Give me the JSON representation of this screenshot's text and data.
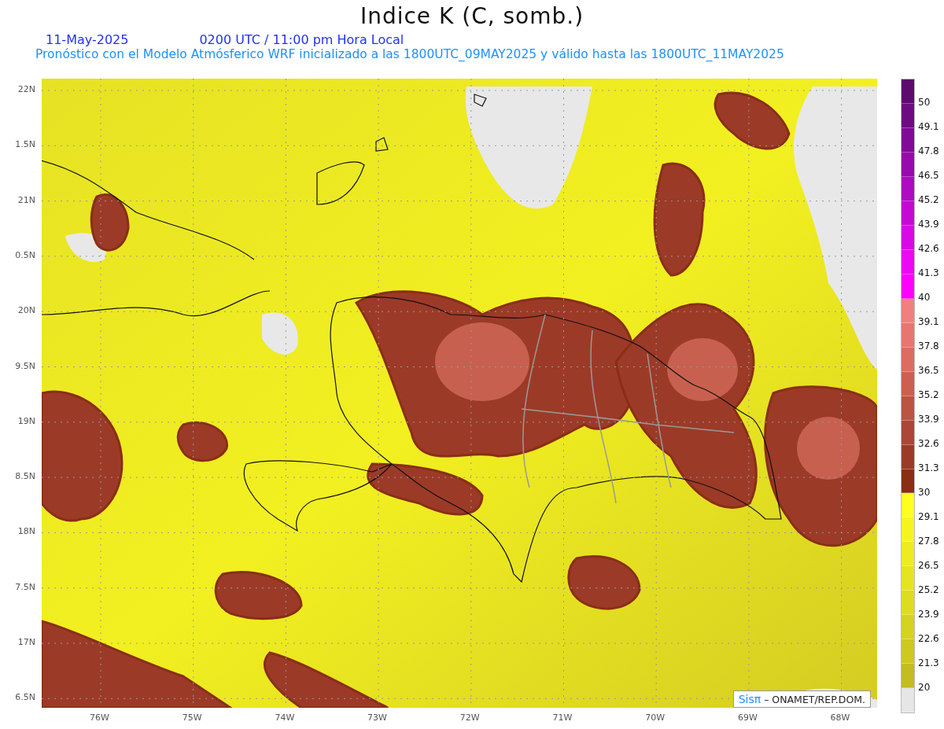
{
  "header": {
    "title": "Indice K (C, somb.)",
    "date": "11-May-2025",
    "time": "0200 UTC / 11:00 pm Hora Local",
    "forecast": "Pronóstico con el Modelo Atmósferico WRF inicializado a las 1800UTC_09MAY2025 y válido hasta las  1800UTC_11MAY2025"
  },
  "map": {
    "y_labels": [
      "22N",
      "1.5N",
      "21N",
      "0.5N",
      "20N",
      "9.5N",
      "19N",
      "8.5N",
      "18N",
      "7.5N",
      "17N",
      "6.5N"
    ],
    "x_labels": [
      "76W",
      "75W",
      "74W",
      "73W",
      "72W",
      "71W",
      "70W",
      "69W",
      "68W"
    ],
    "credit": {
      "brand": "Sisπ",
      "text": "– ONAMET/REP.DOM."
    }
  },
  "legend": {
    "bins": [
      {
        "color": "#5c0a6e"
      },
      {
        "color": "#6e0a82"
      },
      {
        "color": "#820a98"
      },
      {
        "color": "#980aac"
      },
      {
        "color": "#ae0ac0"
      },
      {
        "color": "#c40ad2"
      },
      {
        "color": "#d80ae4"
      },
      {
        "color": "#ec08f2"
      },
      {
        "color": "#ff00ff"
      },
      {
        "color": "#f08080"
      },
      {
        "color": "#e67670"
      },
      {
        "color": "#dc6c60"
      },
      {
        "color": "#cc6050"
      },
      {
        "color": "#bc5444"
      },
      {
        "color": "#ac4636"
      },
      {
        "color": "#9c3a28"
      },
      {
        "color": "#8a2e14"
      },
      {
        "color": "#ffff20"
      },
      {
        "color": "#f6f420"
      },
      {
        "color": "#eeec20"
      },
      {
        "color": "#e6e420"
      },
      {
        "color": "#dedc20"
      },
      {
        "color": "#d6d220"
      },
      {
        "color": "#cec820"
      },
      {
        "color": "#c4bc20"
      },
      {
        "color": "#e6e6e6"
      }
    ],
    "labels": [
      "50",
      "49.1",
      "47.8",
      "46.5",
      "45.2",
      "43.9",
      "42.6",
      "41.3",
      "40",
      "39.1",
      "37.8",
      "36.5",
      "35.2",
      "33.9",
      "32.6",
      "31.3",
      "30",
      "29.1",
      "27.8",
      "26.5",
      "25.2",
      "23.9",
      "22.6",
      "21.3",
      "20"
    ]
  }
}
